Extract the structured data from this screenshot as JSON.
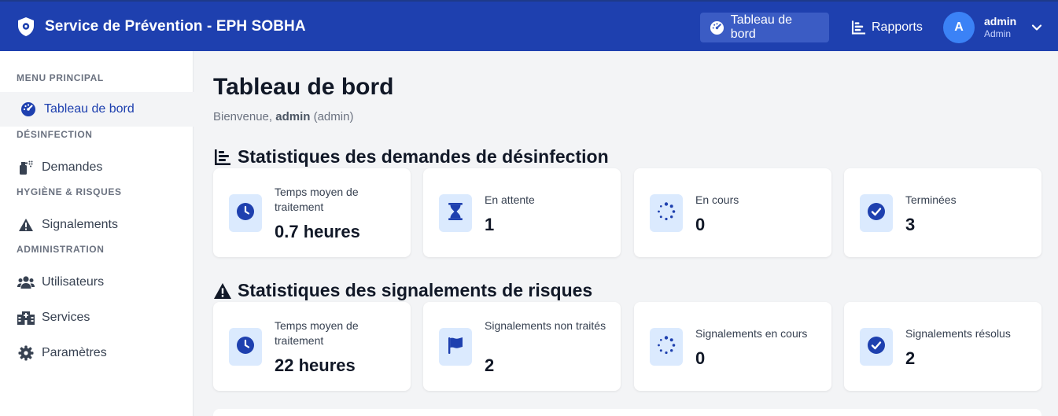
{
  "header": {
    "title": "Service de Prévention - EPH SOBHA",
    "nav": [
      {
        "label": "Tableau de bord",
        "icon": "gauge-icon"
      },
      {
        "label": "Rapports",
        "icon": "chart-bar-icon"
      }
    ],
    "user": {
      "initial": "A",
      "name": "admin",
      "role": "Admin"
    }
  },
  "sidebar": {
    "sections": [
      {
        "label": "MENU PRINCIPAL"
      },
      {
        "label": "DÉSINFECTION"
      },
      {
        "label": "HYGIÈNE & RISQUES"
      },
      {
        "label": "ADMINISTRATION"
      }
    ],
    "items": [
      {
        "label": "Tableau de bord",
        "icon": "gauge-icon"
      },
      {
        "label": "Demandes",
        "icon": "spray-icon"
      },
      {
        "label": "Signalements",
        "icon": "warning-icon"
      },
      {
        "label": "Utilisateurs",
        "icon": "users-icon"
      },
      {
        "label": "Services",
        "icon": "hospital-icon"
      },
      {
        "label": "Paramètres",
        "icon": "gear-icon"
      }
    ]
  },
  "main": {
    "title": "Tableau de bord",
    "welcome_prefix": "Bienvenue,",
    "welcome_user": "admin",
    "welcome_role": "(admin)",
    "disinfection": {
      "heading": "Statistiques des demandes de désinfection",
      "cards": [
        {
          "label": "Temps moyen de traitement",
          "value": "0.7 heures",
          "icon": "clock-icon"
        },
        {
          "label": "En attente",
          "value": "1",
          "icon": "hourglass-icon"
        },
        {
          "label": "En cours",
          "value": "0",
          "icon": "spinner-icon"
        },
        {
          "label": "Terminées",
          "value": "3",
          "icon": "check-circle-icon"
        }
      ]
    },
    "risks": {
      "heading": "Statistiques des signalements de risques",
      "cards": [
        {
          "label": "Temps moyen de traitement",
          "value": "22 heures",
          "icon": "clock-icon"
        },
        {
          "label": "Signalements non traités",
          "value": "2",
          "icon": "flag-icon"
        },
        {
          "label": "Signalements en cours",
          "value": "0",
          "icon": "spinner-icon"
        },
        {
          "label": "Signalements résolus",
          "value": "2",
          "icon": "check-circle-icon"
        }
      ]
    }
  },
  "colors": {
    "primary": "#1e40af",
    "accent": "#3b82f6",
    "icon_bg": "#dbeafe"
  }
}
